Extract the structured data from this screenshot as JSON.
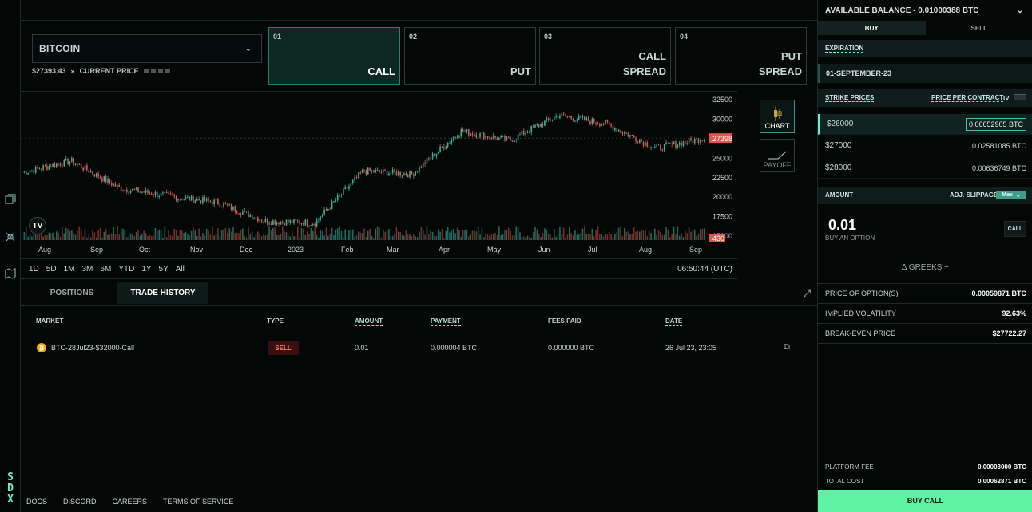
{
  "rail": {
    "brand": [
      "S",
      "D",
      "X"
    ]
  },
  "asset": {
    "name": "BITCOIN",
    "price": "$27393.43",
    "price_label": "CURRENT PRICE"
  },
  "options": [
    {
      "num": "01",
      "label": "CALL",
      "active": true
    },
    {
      "num": "02",
      "label": "PUT",
      "active": false
    },
    {
      "num": "03",
      "label": "CALL\nSPREAD",
      "active": false
    },
    {
      "num": "04",
      "label": "PUT\nSPREAD",
      "active": false
    }
  ],
  "chart": {
    "x_labels": [
      "Aug",
      "Sep",
      "Oct",
      "Nov",
      "Dec",
      "2023",
      "Feb",
      "Mar",
      "Apr",
      "May",
      "Jun",
      "Jul",
      "Aug",
      "Sep"
    ],
    "y_labels": [
      "32500",
      "30000",
      "27500",
      "25000",
      "22500",
      "20000",
      "17500",
      "15000"
    ],
    "last_price": "27398",
    "volume_tag": "430",
    "tv_logo": "TV",
    "ranges": [
      "1D",
      "5D",
      "1M",
      "3M",
      "6M",
      "YTD",
      "1Y",
      "5Y",
      "All"
    ],
    "clock": "06:50:44 (UTC)",
    "side_buttons": {
      "chart": "CHART",
      "payoff": "PAYOFF"
    }
  },
  "chart_data": {
    "type": "line",
    "title": "",
    "x": [
      "Aug",
      "Sep",
      "Oct",
      "Nov",
      "Dec",
      "2023",
      "Feb",
      "Mar",
      "Apr",
      "May",
      "Jun",
      "Jul",
      "Aug",
      "Sep"
    ],
    "series": [
      {
        "values": [
          23000,
          24500,
          21000,
          20000,
          19200,
          16800,
          16600,
          23200,
          22800,
          28300,
          27100,
          30300,
          29200,
          26100,
          27398
        ]
      }
    ],
    "ylim": [
      15000,
      32500
    ]
  },
  "tabs": {
    "positions": "POSITIONS",
    "trade_history": "TRADE HISTORY"
  },
  "table": {
    "headers": {
      "market": "MARKET",
      "type": "TYPE",
      "amount": "AMOUNT",
      "payment": "PAYMENT",
      "fees": "FEES PAID",
      "date": "DATE"
    },
    "rows": [
      {
        "market": "BTC-28Jul23-$32000-Call",
        "type": "SELL",
        "amount": "0.01",
        "payment": "0.000004 BTC",
        "fees": "0.000000 BTC",
        "date": "26 Jul 23, 23:05"
      }
    ]
  },
  "footer": [
    "DOCS",
    "DISCORD",
    "CAREERS",
    "TERMS OF SERVICE"
  ],
  "panel": {
    "balance": "AVAILABLE BALANCE - 0.01000388 BTC",
    "buy": "BUY",
    "sell": "SELL",
    "expiration_label": "EXPIRATION",
    "expiration_value": "01-SEPTEMBER-23",
    "strike_label": "STRIKE PRICES",
    "ppc_label": "PRICE PER CONTRACT",
    "iv_label": "IV",
    "strikes": [
      {
        "strike": "$26000",
        "price": "0.06652905 BTC",
        "selected": true
      },
      {
        "strike": "$27000",
        "price": "0.02581085 BTC",
        "selected": false
      },
      {
        "strike": "$28000",
        "price": "0.00636749 BTC",
        "selected": false
      }
    ],
    "amount_label": "AMOUNT",
    "slippage_label": "ADJ. SLIPPAGE",
    "slippage_value": "Max",
    "amount_value": "0.01",
    "amount_sub": "BUY AN OPTION",
    "call_tag": "CALL",
    "greeks": "Δ GREEKS +",
    "stats": [
      {
        "label": "PRICE OF OPTION(S)",
        "value": "0.00059871 BTC"
      },
      {
        "label": "IMPLIED VOLATILITY",
        "value": "92.63%"
      },
      {
        "label": "BREAK-EVEN PRICE",
        "value": "$27722.27"
      }
    ],
    "platform_fee_label": "PLATFORM FEE",
    "platform_fee_value": "0.00003000 BTC",
    "total_cost_label": "TOTAL COST",
    "total_cost_value": "0.00062871 BTC",
    "buy_button": "BUY CALL"
  }
}
